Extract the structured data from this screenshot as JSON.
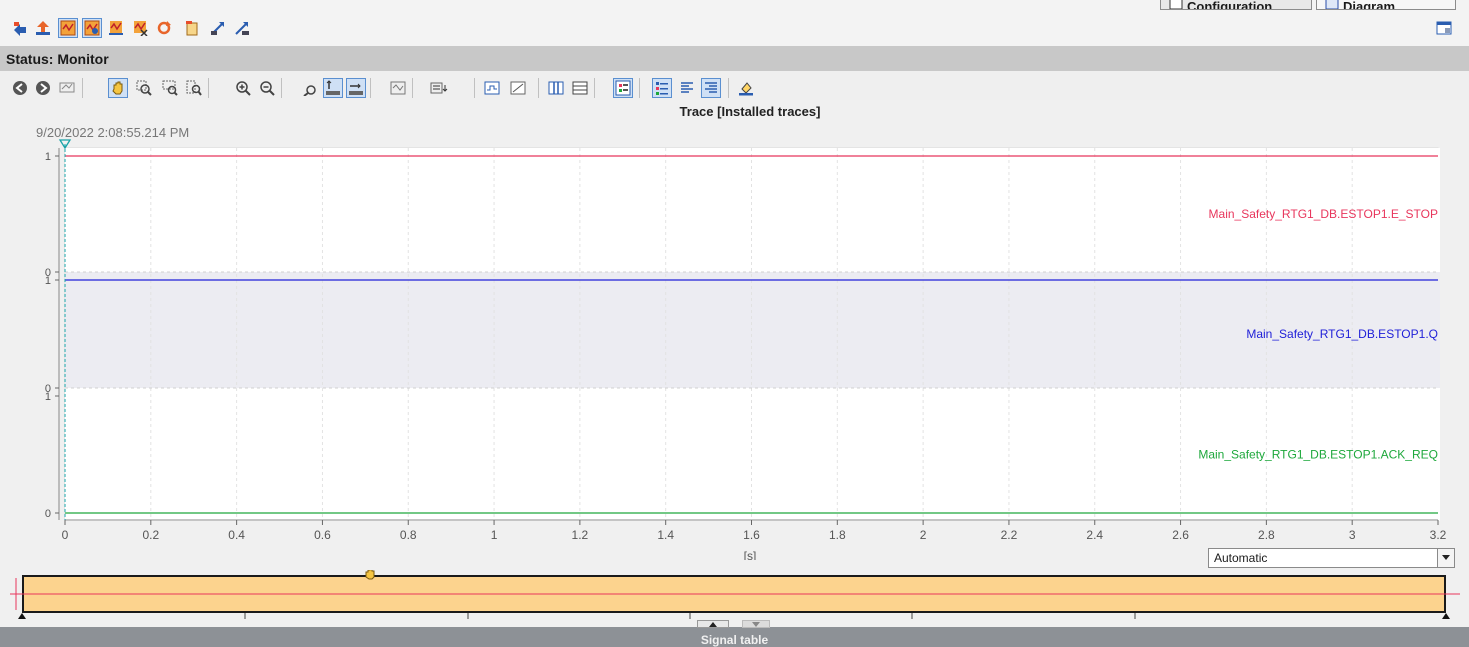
{
  "header": {
    "tabs": [
      {
        "label": "Configuration",
        "icon": "configuration-icon"
      },
      {
        "label": "Diagram",
        "icon": "diagram-icon"
      }
    ]
  },
  "status": {
    "label": "Status: Monitor"
  },
  "chart_title": "Trace [Installed traces]",
  "timestamp": "9/20/2022  2:08:55.214 PM",
  "timebase": {
    "selected": "Automatic"
  },
  "signal_table_label": "Signal table",
  "colors": {
    "estop": "#e8365c",
    "q": "#2020d8",
    "ack_req": "#1ea83c",
    "overview_fill": "#fcd38e",
    "status_bar": "#c8c8c8"
  },
  "chart_data": {
    "type": "line",
    "title": "Trace [Installed traces]",
    "xlabel": "[s]",
    "xlim": [
      0,
      3.2
    ],
    "x_ticks": [
      "0",
      "0.2",
      "0.4",
      "0.6",
      "0.8",
      "1",
      "1.2",
      "1.4",
      "1.6",
      "1.8",
      "2",
      "2.2",
      "2.4",
      "2.6",
      "2.8",
      "3",
      "3.2"
    ],
    "x_tick_values": [
      0,
      0.2,
      0.4,
      0.6,
      0.8,
      1.0,
      1.2,
      1.4,
      1.6,
      1.8,
      2.0,
      2.2,
      2.4,
      2.6,
      2.8,
      3.0,
      3.2
    ],
    "y_ticks": [
      "0",
      "1"
    ],
    "grid": true,
    "series": [
      {
        "name": "Main_Safety_RTG1_DB.ESTOP1.E_STOP",
        "x": [
          0,
          3.2
        ],
        "values": [
          1,
          1
        ]
      },
      {
        "name": "Main_Safety_RTG1_DB.ESTOP1.Q",
        "x": [
          0,
          3.2
        ],
        "values": [
          1,
          1
        ]
      },
      {
        "name": "Main_Safety_RTG1_DB.ESTOP1.ACK_REQ",
        "x": [
          0,
          3.2
        ],
        "values": [
          0,
          0
        ]
      }
    ]
  }
}
